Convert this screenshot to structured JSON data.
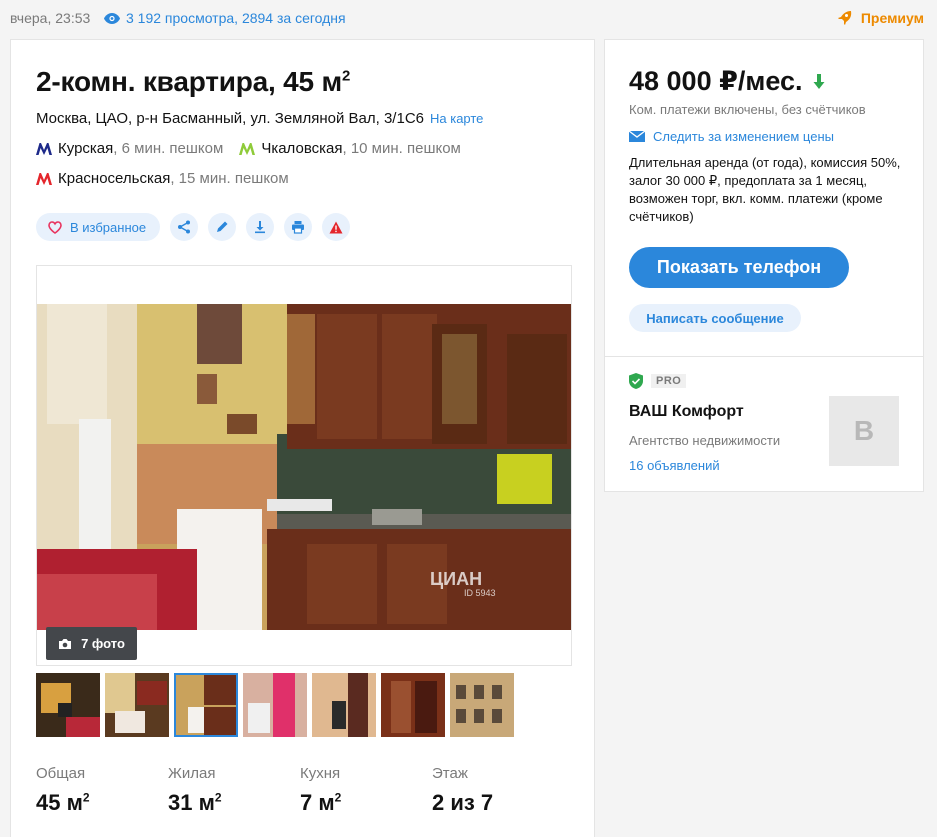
{
  "top": {
    "date": "вчера, 23:53",
    "views": "3 192 просмотра, 2894 за сегодня",
    "premium": "Премиум"
  },
  "listing": {
    "title": "2-комн. квартира, 45 м",
    "title_sup": "2",
    "address": "Москва, ЦАО, р-н Басманный, ул. Земляной Вал, 3/1С6",
    "map_link": "На карте",
    "metro": [
      {
        "station": "Курская",
        "distance": ", 6 мин. пешком",
        "color": "#1e2a8a"
      },
      {
        "station": "Чкаловская",
        "distance": ", 10 мин. пешком",
        "color": "#8fcb3a"
      },
      {
        "station": "Красносельская",
        "distance": ", 15 мин. пешком",
        "color": "#e4262c"
      }
    ],
    "favorite_label": "В избранное",
    "photo_count": "7 фото",
    "watermark": "ЦИАН",
    "watermark_id": "ID 5943"
  },
  "specs": [
    {
      "label": "Общая",
      "value": "45 м",
      "sup": "2"
    },
    {
      "label": "Жилая",
      "value": "31 м",
      "sup": "2"
    },
    {
      "label": "Кухня",
      "value": "7 м",
      "sup": "2"
    },
    {
      "label": "Этаж",
      "value": "2 из 7",
      "sup": ""
    }
  ],
  "sidebar": {
    "price": "48 000 ₽/мес.",
    "price_note": "Ком. платежи включены, без счётчиков",
    "follow": "Следить за изменением цены",
    "terms": "Длительная аренда (от года), комиссия 50%, залог 30 000 ₽, предоплата за 1 месяц, возможен торг, вкл. комм. платежи (кроме счётчиков)",
    "phone_button": "Показать телефон",
    "message_button": "Написать сообщение",
    "pro": "PRO",
    "agency": "ВАШ Комфорт",
    "agency_type": "Агентство недвижимости",
    "agency_ads": "16 объявлений",
    "avatar_letter": "В"
  },
  "colors": {
    "accent": "#2b87db",
    "premium": "#ed8a00",
    "price_down": "#2fa84f",
    "favorite_heart": "#e8345f",
    "warning": "#e4262c"
  }
}
